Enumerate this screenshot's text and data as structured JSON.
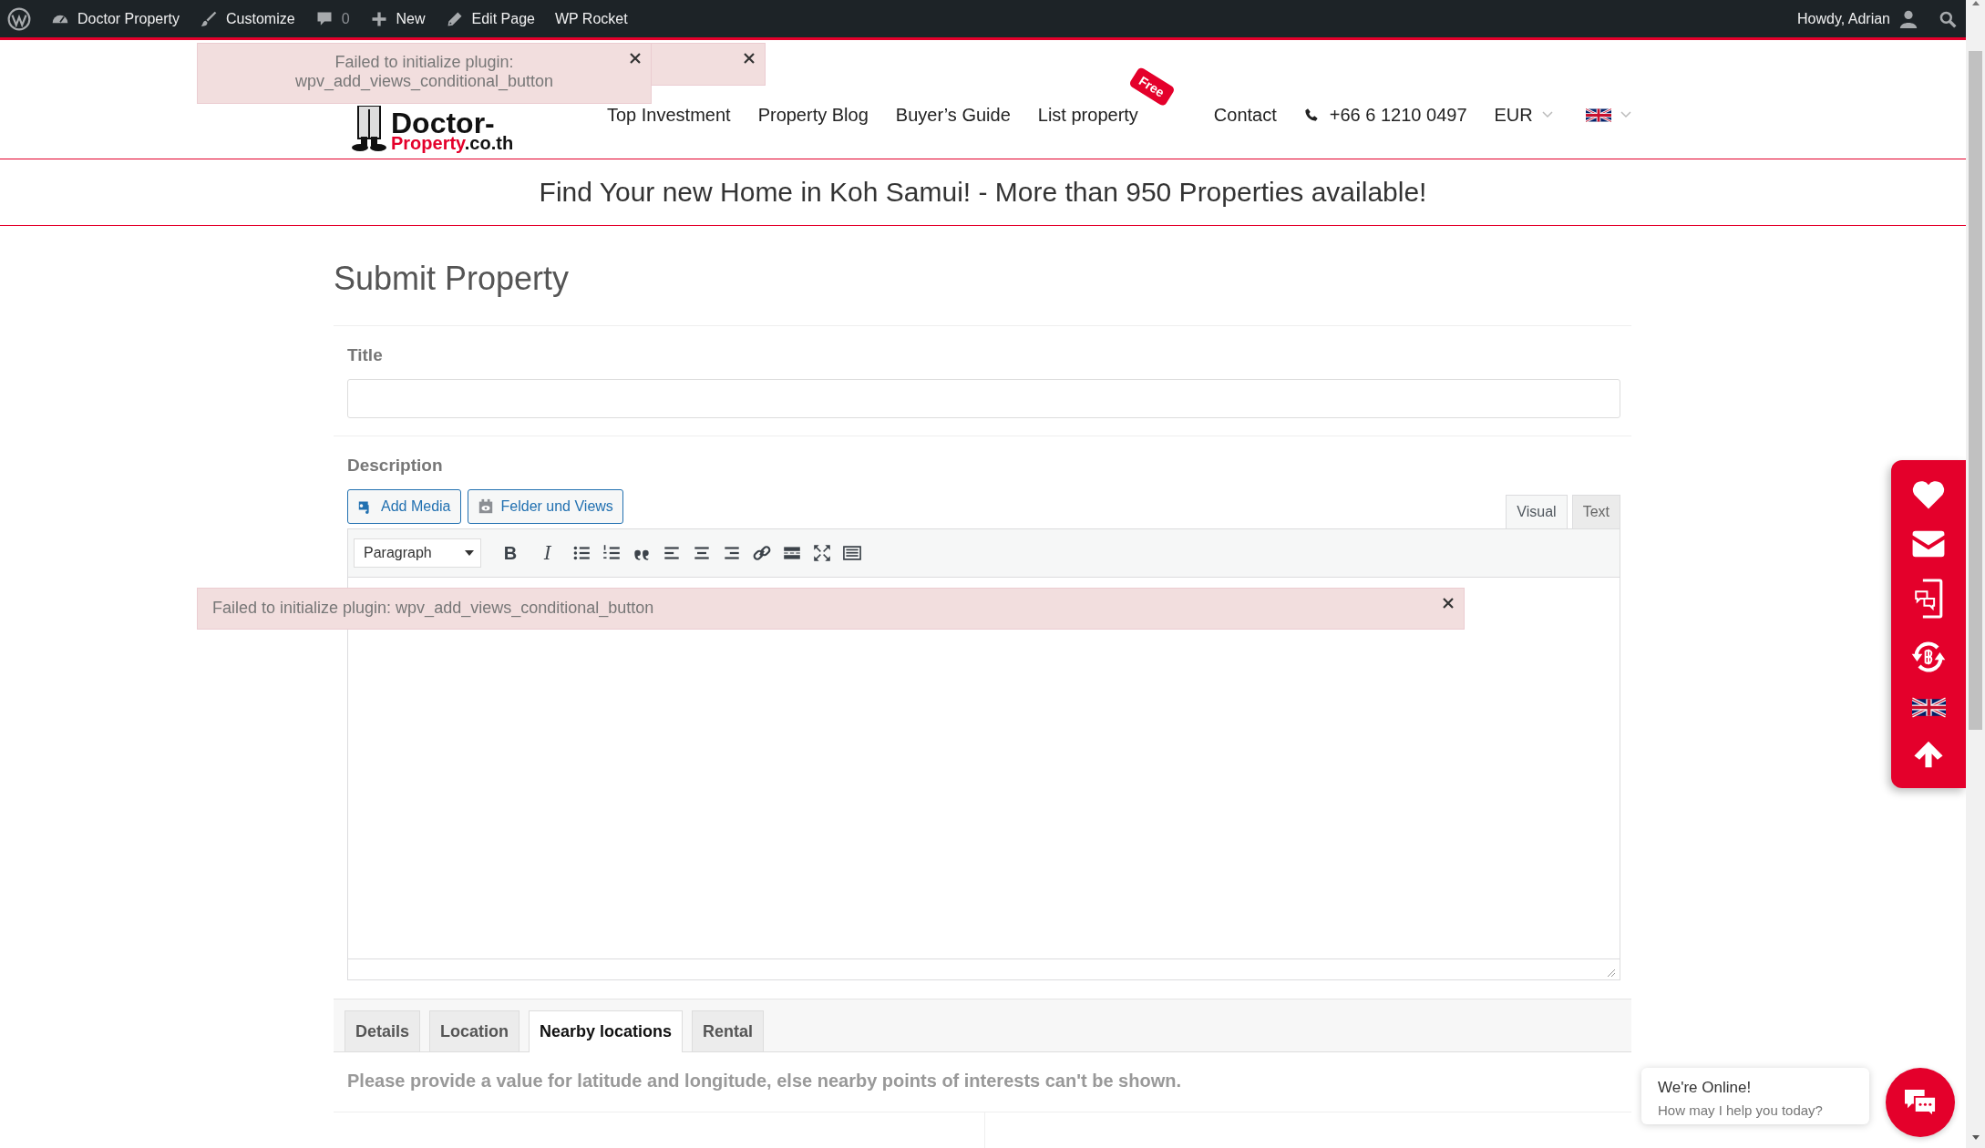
{
  "admin_bar": {
    "items": [
      {
        "kind": "logo"
      },
      {
        "kind": "site",
        "label": "Doctor Property"
      },
      {
        "kind": "customize",
        "label": "Customize"
      },
      {
        "kind": "comments",
        "label": "0"
      },
      {
        "kind": "new",
        "label": "New"
      },
      {
        "kind": "edit",
        "label": "Edit Page"
      },
      {
        "kind": "plain",
        "label": "WP Rocket"
      }
    ],
    "account": "Howdy, Adrian"
  },
  "notices": [
    {
      "kind": "behind"
    },
    {
      "kind": "header",
      "text": "Failed to initialize plugin: wpv_add_views_conditional_button"
    },
    {
      "kind": "editor",
      "text": "Failed to initialize plugin: wpv_add_views_conditional_button"
    }
  ],
  "logo": {
    "name": "Doctor-",
    "highlight": "Property",
    "suffix": ".co.th"
  },
  "nav": [
    {
      "label": "Top Investment"
    },
    {
      "label": "Property Blog"
    },
    {
      "label": "Buyer’s Guide"
    },
    {
      "label": "List property",
      "badge": "Free"
    },
    {
      "label": "Contact"
    }
  ],
  "phone": "+66 6 1210 0497",
  "currency": "EUR",
  "banner": "Find Your new Home in Koh Samui! - More than 950 Properties available!",
  "page_title": "Submit Property",
  "title_field": {
    "label": "Title"
  },
  "description": {
    "label": "Description",
    "buttons": [
      {
        "kind": "media",
        "label": "Add Media"
      },
      {
        "kind": "views",
        "label": "Felder und Views"
      }
    ],
    "modes": [
      {
        "label": "Visual",
        "selected": true
      },
      {
        "label": "Text",
        "selected": false
      }
    ],
    "format": "Paragraph",
    "toolbar": [
      {
        "kind": "bold",
        "glyph": "B"
      },
      {
        "kind": "italic",
        "glyph": "I"
      },
      {
        "kind": "bullet-list"
      },
      {
        "kind": "numbered-list"
      },
      {
        "kind": "blockquote"
      },
      {
        "kind": "align-left"
      },
      {
        "kind": "align-center"
      },
      {
        "kind": "align-right"
      },
      {
        "kind": "link"
      },
      {
        "kind": "read-more"
      },
      {
        "kind": "fullscreen"
      },
      {
        "kind": "toolbar-toggle"
      }
    ]
  },
  "tabs": [
    {
      "label": "Details",
      "selected": false
    },
    {
      "label": "Location",
      "selected": false
    },
    {
      "label": "Nearby locations",
      "selected": true
    },
    {
      "label": "Rental",
      "selected": false
    }
  ],
  "tab_message": "Please provide a value for latitude and longitude, else nearby points of interests can't be shown.",
  "side_panel": [
    {
      "kind": "favorites"
    },
    {
      "kind": "mail"
    },
    {
      "kind": "chat"
    },
    {
      "kind": "currency"
    },
    {
      "kind": "language"
    },
    {
      "kind": "scroll-top"
    }
  ],
  "chat": {
    "title": "We're Online!",
    "subtitle": "How may I help you today?"
  }
}
